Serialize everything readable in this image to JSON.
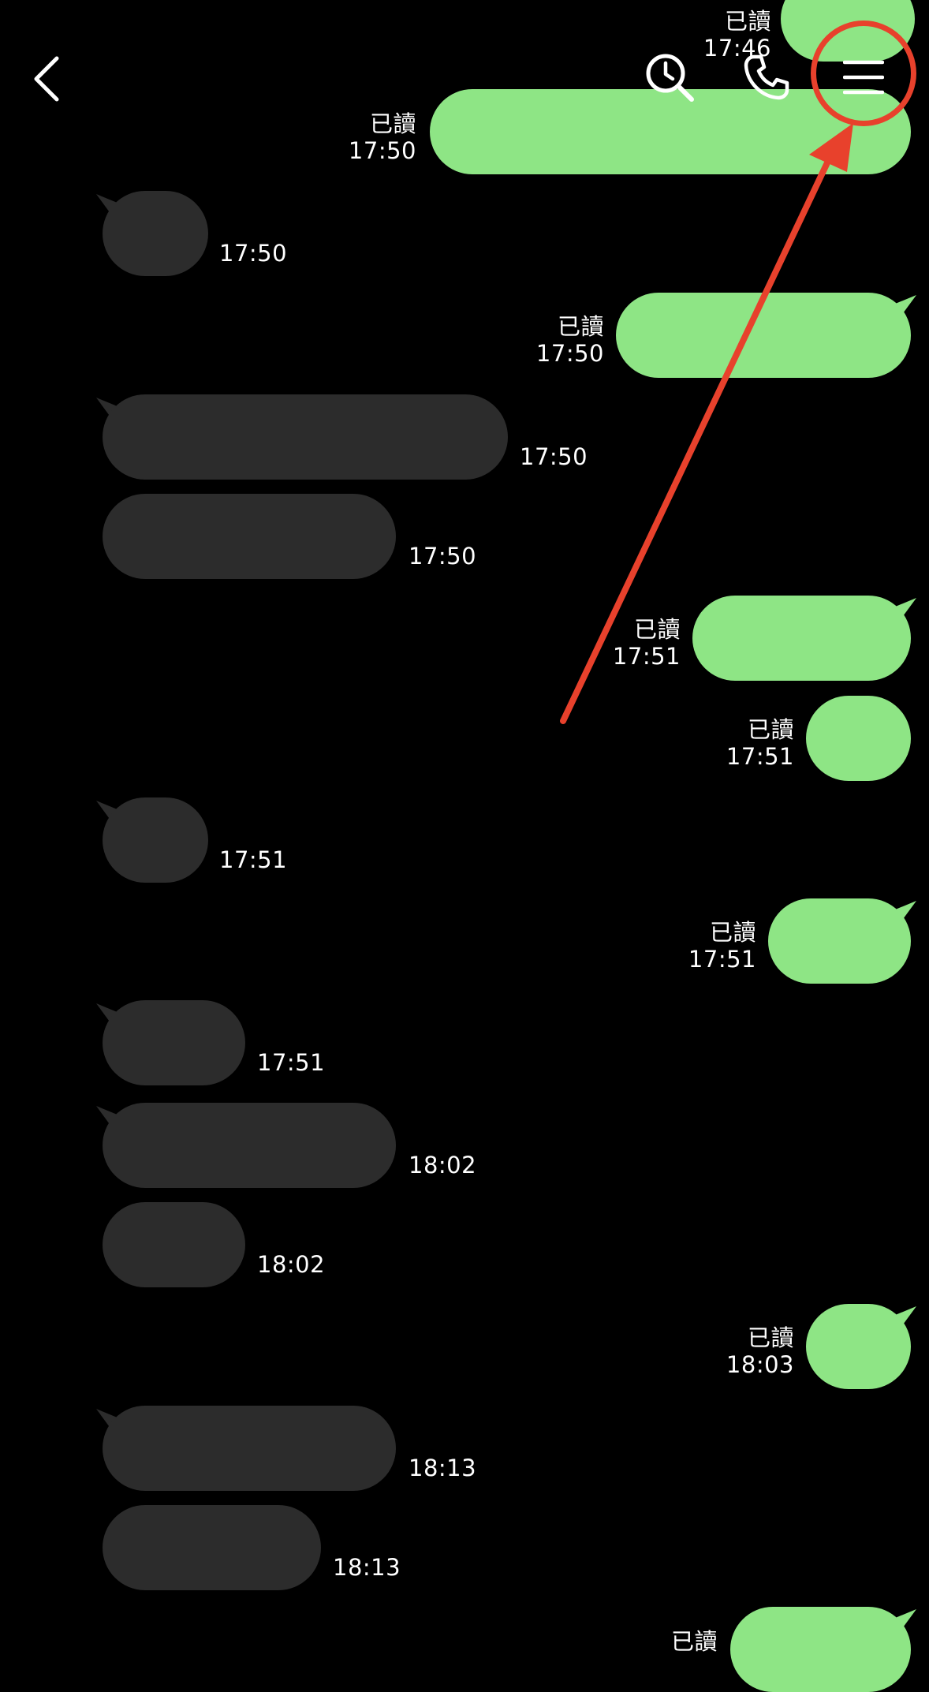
{
  "colors": {
    "background": "#000000",
    "incoming_bubble": "#2c2c2c",
    "outgoing_bubble": "#8ee585",
    "annotation": "#e8412c"
  },
  "header": {
    "back_icon": "chevron-left-icon",
    "search_icon": "search-clock-icon",
    "call_icon": "phone-icon",
    "menu_icon": "hamburger-menu-icon"
  },
  "messages": [
    {
      "direction": "out",
      "read": "已讀",
      "time": "17:46"
    },
    {
      "direction": "out",
      "read": "已讀",
      "time": "17:50"
    },
    {
      "direction": "in",
      "time": "17:50"
    },
    {
      "direction": "out",
      "read": "已讀",
      "time": "17:50"
    },
    {
      "direction": "in",
      "time": "17:50"
    },
    {
      "direction": "in",
      "time": "17:50"
    },
    {
      "direction": "out",
      "read": "已讀",
      "time": "17:51"
    },
    {
      "direction": "out",
      "read": "已讀",
      "time": "17:51"
    },
    {
      "direction": "in",
      "time": "17:51"
    },
    {
      "direction": "out",
      "read": "已讀",
      "time": "17:51"
    },
    {
      "direction": "in",
      "time": "17:51"
    },
    {
      "direction": "in",
      "time": "18:02"
    },
    {
      "direction": "in",
      "time": "18:02"
    },
    {
      "direction": "out",
      "read": "已讀",
      "time": "18:03"
    },
    {
      "direction": "in",
      "time": "18:13"
    },
    {
      "direction": "in",
      "time": "18:13"
    },
    {
      "direction": "out",
      "read": "已讀",
      "time": ""
    }
  ]
}
